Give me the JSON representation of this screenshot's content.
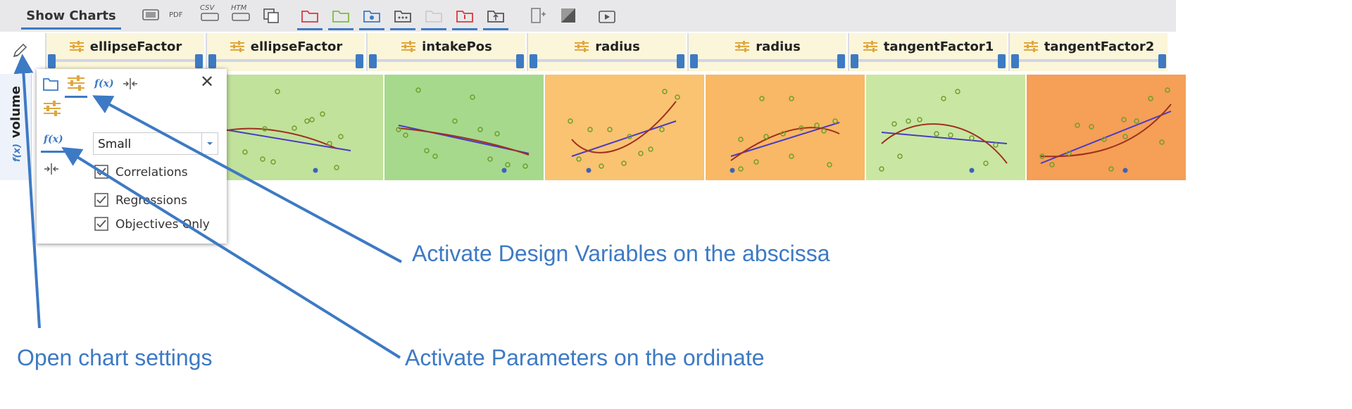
{
  "toolbar": {
    "tab_label": "Show Charts",
    "pdf_label": "PDF",
    "csv_label": "CSV",
    "htm_label": "HTM"
  },
  "columns": [
    {
      "label": "ellipseFactor",
      "bg": "#c0e29a"
    },
    {
      "label": "ellipseFactor",
      "bg": "#c0e29a"
    },
    {
      "label": "intakePos",
      "bg": "#a6d98c"
    },
    {
      "label": "radius",
      "bg": "#f9c371"
    },
    {
      "label": "radius",
      "bg": "#f8b865"
    },
    {
      "label": "tangentFactor1",
      "bg": "#c9e7a2"
    },
    {
      "label": "tangentFactor2",
      "bg": "#f59f57"
    }
  ],
  "row": {
    "label": "volume",
    "fx": "f(x)"
  },
  "panel": {
    "fx_label": "f(x)",
    "size": "Small",
    "checks": [
      "Correlations",
      "Regressions",
      "Objectives Only"
    ]
  },
  "annotations": {
    "design_vars": "Activate Design Variables on the abscissa",
    "chart_settings": "Open chart settings",
    "parameters": "Activate Parameters on the ordinate"
  },
  "colors": {
    "accent": "#3d7ac4",
    "slider_icon": "#e0a63c",
    "regression_line": "#4a3bc4",
    "fit_curve": "#a0301e",
    "point": "#6f9e2a"
  }
}
